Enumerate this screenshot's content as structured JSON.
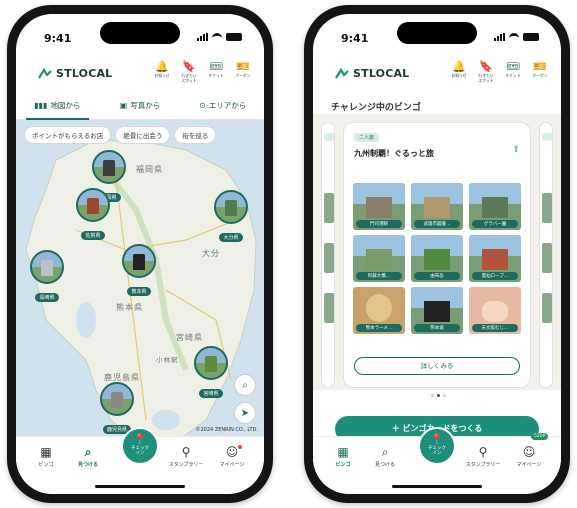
{
  "status": {
    "time": "9:41"
  },
  "brand": {
    "name": "STLOCAL"
  },
  "header_icons": [
    {
      "name": "bell-icon",
      "glyph": "🔔",
      "label": "お知らせ"
    },
    {
      "name": "bookmark-icon",
      "glyph": "🔖",
      "label": "行きたい\nスポット"
    },
    {
      "name": "ticket-icon",
      "glyph": "🎟",
      "label": "チケット"
    },
    {
      "name": "coupon-icon",
      "glyph": "🎫",
      "label": "クーポン"
    }
  ],
  "left": {
    "tabs": [
      {
        "icon": "▮▮▮",
        "label": "地図から"
      },
      {
        "icon": "▣",
        "label": "写真から"
      },
      {
        "icon": "⊙",
        "label": "エリアから"
      }
    ],
    "chips": [
      "ポイントがもらえるお店",
      "絶景に出会う",
      "街を巡る"
    ],
    "map_labels": [
      "福岡県",
      "大分県",
      "宮崎県",
      "熊本県",
      "鹿児島県",
      "小林駅",
      "大分"
    ],
    "pins": [
      {
        "label": "福岡県"
      },
      {
        "label": "佐賀県"
      },
      {
        "label": "大分県"
      },
      {
        "label": "長崎県"
      },
      {
        "label": "熊本県"
      },
      {
        "label": "宮崎県"
      },
      {
        "label": "鹿児島県"
      }
    ],
    "copyright": "©2024 ZENRIN CO., LTD."
  },
  "nav": {
    "items": [
      {
        "icon": "▦",
        "label": "ビンゴ"
      },
      {
        "icon": "⌕",
        "label": "見つける"
      },
      {
        "icon": "⚲",
        "label": "スタンプラリー"
      },
      {
        "icon": "☺",
        "label": "マイページ"
      }
    ],
    "checkin": {
      "icon": "📍",
      "label": "チェック\nイン"
    }
  },
  "right": {
    "section_title": "チャレンジ中のビンゴ",
    "card": {
      "tag": "二人旅",
      "title": "九州制覇！ぐるっと旅",
      "cells": [
        "門司港駅",
        "武雄市図書…",
        "グラバー園",
        "阿蘇大橋…",
        "由布岳",
        "雲仙ロープ…",
        "熊本ラーメ…",
        "熊本城",
        "天文館むじ…"
      ],
      "detail_label": "詳しくみる"
    },
    "create_label": "＋ ビンゴカードをつくる",
    "points_badge": "520P"
  }
}
